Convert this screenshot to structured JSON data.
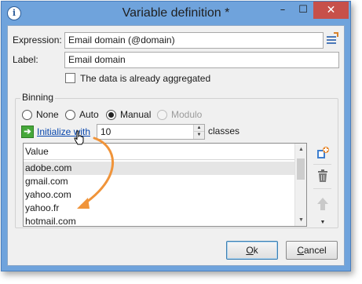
{
  "window": {
    "title": "Variable definition *",
    "app_icon": "i",
    "minimize": "–",
    "maximize": "☐",
    "close": "✕"
  },
  "form": {
    "expression_label": "Expression:",
    "expression_value": "Email domain (@domain)",
    "label_label": "Label:",
    "label_value": "Email domain",
    "aggregated_label": "The data is already aggregated",
    "aggregated_checked": false
  },
  "binning": {
    "group_title": "Binning",
    "options": [
      {
        "label": "None",
        "selected": false,
        "enabled": true
      },
      {
        "label": "Auto",
        "selected": false,
        "enabled": true
      },
      {
        "label": "Manual",
        "selected": true,
        "enabled": true
      },
      {
        "label": "Modulo",
        "selected": false,
        "enabled": false
      }
    ],
    "initialize_label": "Initialize with",
    "count_value": "10",
    "classes_label": "classes",
    "list_header": "Value",
    "values": [
      "adobe.com",
      "gmail.com",
      "yahoo.com",
      "yahoo.fr",
      "hotmail.com"
    ],
    "selected_index": 0
  },
  "icons": {
    "expression_edit": "expression-edit-icon",
    "add_value": "add-value-icon",
    "delete": "trash-icon",
    "move_up": "arrow-up-icon",
    "dropdown": "chevron-down-icon"
  },
  "buttons": {
    "ok_hotkey": "O",
    "ok_rest": "k",
    "cancel_hotkey": "C",
    "cancel_rest": "ancel"
  },
  "colors": {
    "window_frame": "#6fa3dc",
    "close_button": "#c7504a",
    "annotation_arrow": "#f0943a",
    "link": "#0645ad"
  }
}
